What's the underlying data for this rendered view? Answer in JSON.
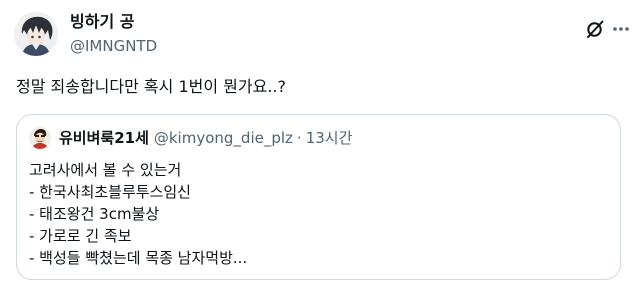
{
  "author": {
    "display_name": "빙하기 공",
    "handle": "@IMNGNTD",
    "avatar_icon": "anime-character-avatar"
  },
  "header_actions": {
    "grok_icon": "grok-icon",
    "more_icon": "more-dots-icon"
  },
  "tweet": {
    "text": "정말 죄송합니다만 혹시 1번이 뭔가요..?"
  },
  "quote": {
    "author": {
      "display_name": "유비벼룩21세",
      "handle": "@kimyong_die_plz",
      "separator": "·",
      "time": "13시간",
      "avatar_icon": "cartoon-avatar"
    },
    "lines": [
      "고려사에서 볼 수 있는거",
      "- 한국사최초블루투스임신",
      "- 태조왕건 3cm불상",
      "- 가로로 긴 족보",
      "- 백성들 빡쳤는데 목종 남자먹방..."
    ]
  },
  "colors": {
    "text_primary": "#0f1419",
    "text_secondary": "#536471",
    "border": "#cfd9de",
    "background": "#ffffff"
  }
}
